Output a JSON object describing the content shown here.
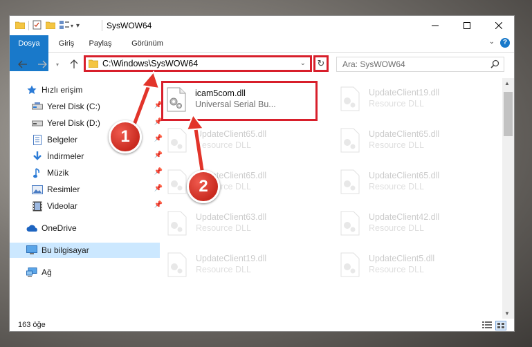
{
  "window": {
    "title": "SysWOW64"
  },
  "ribbon": {
    "tabs": [
      "Dosya",
      "Giriş",
      "Paylaş",
      "Görünüm"
    ]
  },
  "address": {
    "path": "C:\\Windows\\SysWOW64"
  },
  "search": {
    "placeholder": "Ara: SysWOW64"
  },
  "nav": {
    "items": [
      {
        "label": "Hızlı erişim",
        "icon": "star-icon"
      },
      {
        "label": "Yerel Disk (C:)",
        "icon": "drive-icon",
        "pinned": true
      },
      {
        "label": "Yerel Disk (D:)",
        "icon": "drive-icon",
        "pinned": true
      },
      {
        "label": "Belgeler",
        "icon": "documents-icon",
        "pinned": true
      },
      {
        "label": "İndirmeler",
        "icon": "download-icon",
        "pinned": true
      },
      {
        "label": "Müzik",
        "icon": "music-icon",
        "pinned": true
      },
      {
        "label": "Resimler",
        "icon": "pictures-icon",
        "pinned": true
      },
      {
        "label": "Videolar",
        "icon": "videos-icon",
        "pinned": true
      },
      {
        "label": "OneDrive",
        "icon": "cloud-icon"
      },
      {
        "label": "Bu bilgisayar",
        "icon": "computer-icon",
        "selected": true
      },
      {
        "label": "Ağ",
        "icon": "network-icon"
      }
    ]
  },
  "files": [
    {
      "name": "icam5com.dll",
      "desc": "Universal Serial Bu..."
    },
    {
      "name": "UpdateClient19.dll",
      "desc": "Resource DLL"
    },
    {
      "name": "UpdateClient65.dll",
      "desc": "Resource DLL"
    },
    {
      "name": "UpdateClient65.dll",
      "desc": "Resource DLL"
    },
    {
      "name": "UpdateClient65.dll",
      "desc": "Resource DLL"
    },
    {
      "name": "UpdateClient65.dll",
      "desc": "Resource DLL"
    },
    {
      "name": "UpdateClient63.dll",
      "desc": "Resource DLL"
    },
    {
      "name": "UpdateClient42.dll",
      "desc": "Resource DLL"
    },
    {
      "name": "UpdateClient19.dll",
      "desc": "Resource DLL"
    },
    {
      "name": "UpdateClient5.dll",
      "desc": "Resource DLL"
    }
  ],
  "status": {
    "count": "163 öğe"
  },
  "annotations": [
    "1",
    "2"
  ],
  "colors": {
    "accent": "#1979ca",
    "highlight": "#d81f2b",
    "selected": "#cce8ff"
  }
}
